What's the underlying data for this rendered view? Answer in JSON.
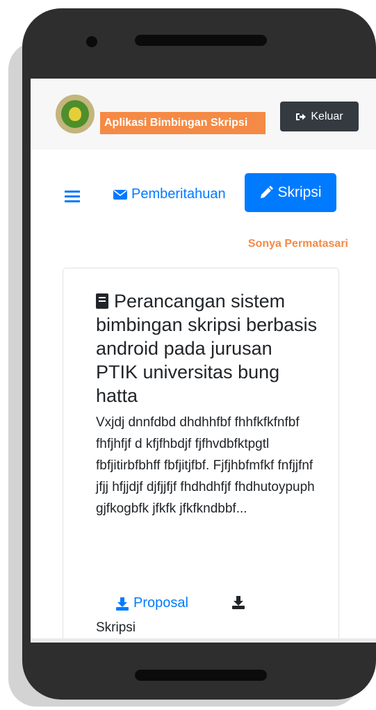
{
  "navbar": {
    "app_title": "Aplikasi Bimbingan Skripsi",
    "logout_label": "Keluar"
  },
  "nav": {
    "notifications_label": "Pemberitahuan",
    "skripsi_label": "Skripsi"
  },
  "user": {
    "name": "Sonya Permatasari"
  },
  "card": {
    "title": "Perancangan sistem bimbingan skripsi berbasis android pada jurusan PTIK universitas bung hatta",
    "description": "Vxjdj dnnfdbd dhdhhfbf fhhfkfkfnfbf fhfjhfjf d kfjfhbdjf fjfhvdbfktpgtl fbfjitirbfbhff fbfjitjfbf. Fjfjhbfmfkf fnfjjfnf jfjj hfjjdjf djfjjfjf fhdhdhfjf fhdhutoypuph gjfkogbfk jfkfk jfkfkndbbf...",
    "proposal_label": "Proposal",
    "skripsi_label": "Skripsi"
  },
  "colors": {
    "primary": "#007bff",
    "accent": "#f48a45",
    "dark": "#343a40"
  },
  "icons": {
    "logout": "sign-out-icon",
    "notifications": "envelope-icon",
    "skripsi": "pencil-icon",
    "title": "book-icon",
    "download": "download-icon"
  }
}
